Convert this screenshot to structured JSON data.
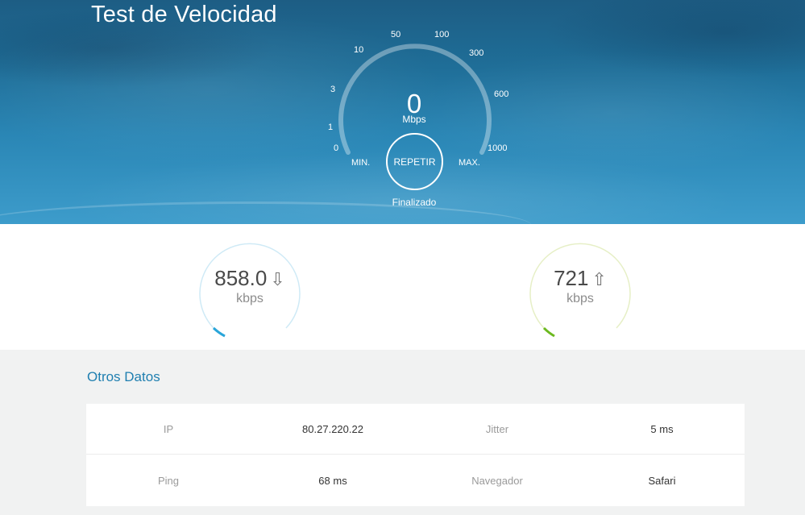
{
  "hero": {
    "title": "Test de Velocidad",
    "gauge": {
      "scale": [
        "0",
        "1",
        "3",
        "10",
        "50",
        "100",
        "300",
        "600",
        "1000"
      ],
      "speed": "0",
      "unit": "Mbps",
      "min_label": "MIN.",
      "max_label": "MAX.",
      "button_label": "REPETIR",
      "status": "Finalizado"
    }
  },
  "results": {
    "download": {
      "value": "858.0",
      "unit": "kbps",
      "icon": "arrow-down-icon",
      "color": "#29a5d9",
      "ring_color": "#cfeaf6"
    },
    "upload": {
      "value": "721",
      "unit": "kbps",
      "icon": "arrow-up-icon",
      "color": "#6cb91f",
      "ring_color": "#e6efc6"
    }
  },
  "otros_datos": {
    "title": "Otros Datos",
    "rows": [
      {
        "label1": "IP",
        "value1": "80.27.220.22",
        "label2": "Jitter",
        "value2": "5 ms"
      },
      {
        "label1": "Ping",
        "value1": "68 ms",
        "label2": "Navegador",
        "value2": "Safari"
      }
    ]
  },
  "colors": {
    "accent": "#1f7fb0",
    "hero_top": "#1d5d84",
    "hero_bottom": "#3d9ccb"
  }
}
